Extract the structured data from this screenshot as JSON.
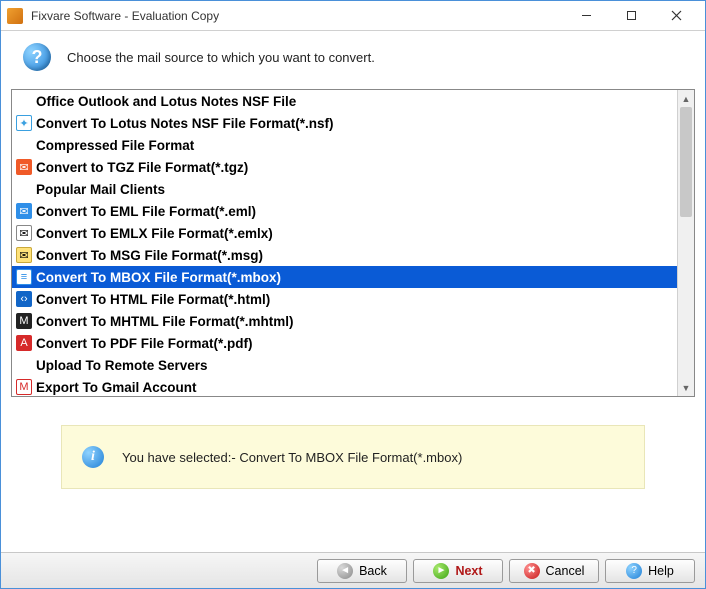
{
  "window": {
    "title": "Fixvare Software - Evaluation Copy"
  },
  "header": {
    "question_icon": "question-icon",
    "text": "Choose the mail source to which you want to convert."
  },
  "list": {
    "rows": [
      {
        "kind": "category",
        "label": "Office Outlook and Lotus Notes NSF File",
        "icon": "blank"
      },
      {
        "kind": "item",
        "label": "Convert To Lotus Notes NSF File Format(*.nsf)",
        "icon": "nsf"
      },
      {
        "kind": "category",
        "label": "Compressed File Format",
        "icon": "blank"
      },
      {
        "kind": "item",
        "label": "Convert to TGZ File Format(*.tgz)",
        "icon": "tgz"
      },
      {
        "kind": "category",
        "label": "Popular Mail Clients",
        "icon": "blank"
      },
      {
        "kind": "item",
        "label": "Convert To EML File Format(*.eml)",
        "icon": "eml"
      },
      {
        "kind": "item",
        "label": "Convert To EMLX File Format(*.emlx)",
        "icon": "emlx"
      },
      {
        "kind": "item",
        "label": "Convert To MSG File Format(*.msg)",
        "icon": "msg"
      },
      {
        "kind": "item",
        "label": "Convert To MBOX File Format(*.mbox)",
        "icon": "mbox",
        "selected": true
      },
      {
        "kind": "item",
        "label": "Convert To HTML File Format(*.html)",
        "icon": "html"
      },
      {
        "kind": "item",
        "label": "Convert To MHTML File Format(*.mhtml)",
        "icon": "mhtml"
      },
      {
        "kind": "item",
        "label": "Convert To PDF File Format(*.pdf)",
        "icon": "pdf"
      },
      {
        "kind": "category",
        "label": "Upload To Remote Servers",
        "icon": "blank"
      },
      {
        "kind": "item",
        "label": "Export To Gmail Account",
        "icon": "gmail"
      }
    ]
  },
  "infobox": {
    "text": "You have selected:- Convert To MBOX File Format(*.mbox)"
  },
  "footer": {
    "back": "Back",
    "next": "Next",
    "cancel": "Cancel",
    "help": "Help"
  },
  "icon_glyphs": {
    "nsf": "✦",
    "tgz": "✉",
    "eml": "✉",
    "emlx": "✉",
    "msg": "✉",
    "mbox": "≡",
    "html": "‹›",
    "mhtml": "M",
    "pdf": "A",
    "gmail": "M",
    "blank": ""
  }
}
